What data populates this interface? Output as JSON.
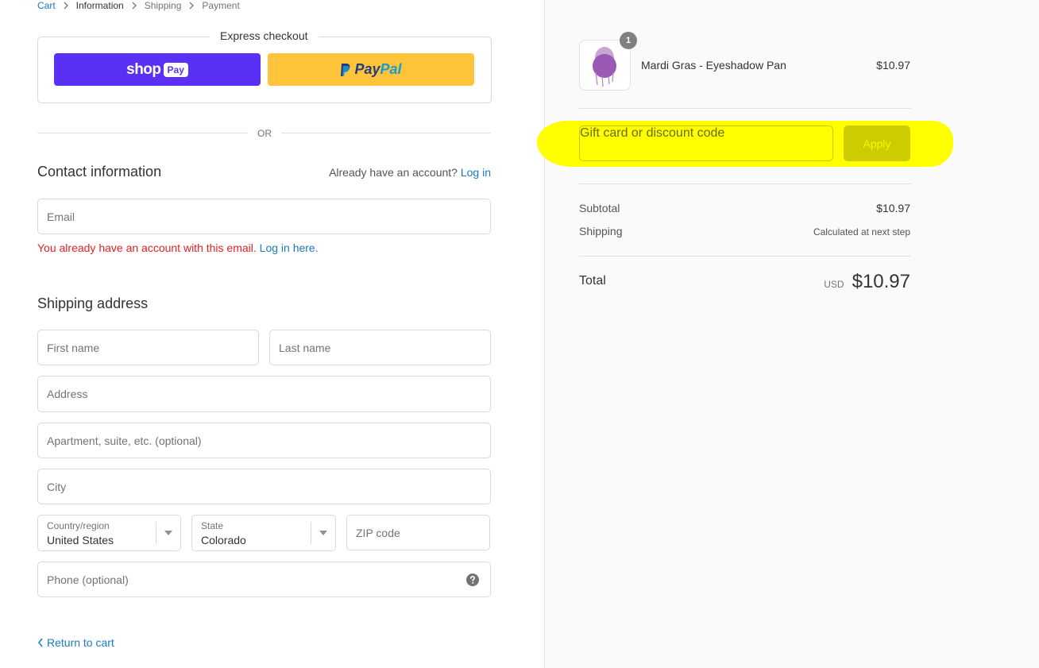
{
  "breadcrumb": {
    "cart": "Cart",
    "information": "Information",
    "shipping": "Shipping",
    "payment": "Payment"
  },
  "express": {
    "title": "Express checkout",
    "shoppay_word": "shop",
    "shoppay_badge": "Pay",
    "paypal_pay": "Pay",
    "paypal_pal": "Pal"
  },
  "divider_text": "OR",
  "contact": {
    "title": "Contact information",
    "account_prompt": "Already have an account?",
    "login_link": "Log in",
    "email_placeholder": "Email",
    "error_text": "You already have an account with this email.",
    "error_link": "Log in here."
  },
  "shipping": {
    "title": "Shipping address",
    "first_name": "First name",
    "last_name": "Last name",
    "address": "Address",
    "apartment": "Apartment, suite, etc. (optional)",
    "city": "City",
    "country_label": "Country/region",
    "country_value": "United States",
    "state_label": "State",
    "state_value": "Colorado",
    "zip": "ZIP code",
    "phone": "Phone (optional)"
  },
  "return_link": "Return to cart",
  "order": {
    "item_name": "Mardi Gras - Eyeshadow Pan",
    "item_price": "$10.97",
    "item_qty": "1",
    "discount_placeholder": "Gift card or discount code",
    "apply_label": "Apply",
    "subtotal_label": "Subtotal",
    "subtotal_value": "$10.97",
    "shipping_label": "Shipping",
    "shipping_value": "Calculated at next step",
    "total_label": "Total",
    "currency": "USD",
    "total_value": "$10.97"
  },
  "colors": {
    "accent": "#197bbd",
    "shoppay": "#5a31f4",
    "paypal": "#ffc439",
    "error": "#e22120",
    "highlight": "#ffff00",
    "swatch": "#9b59b6"
  },
  "icons": [
    "chevron-right-icon",
    "chevron-left-icon",
    "help-icon",
    "dropdown-arrow-icon"
  ]
}
